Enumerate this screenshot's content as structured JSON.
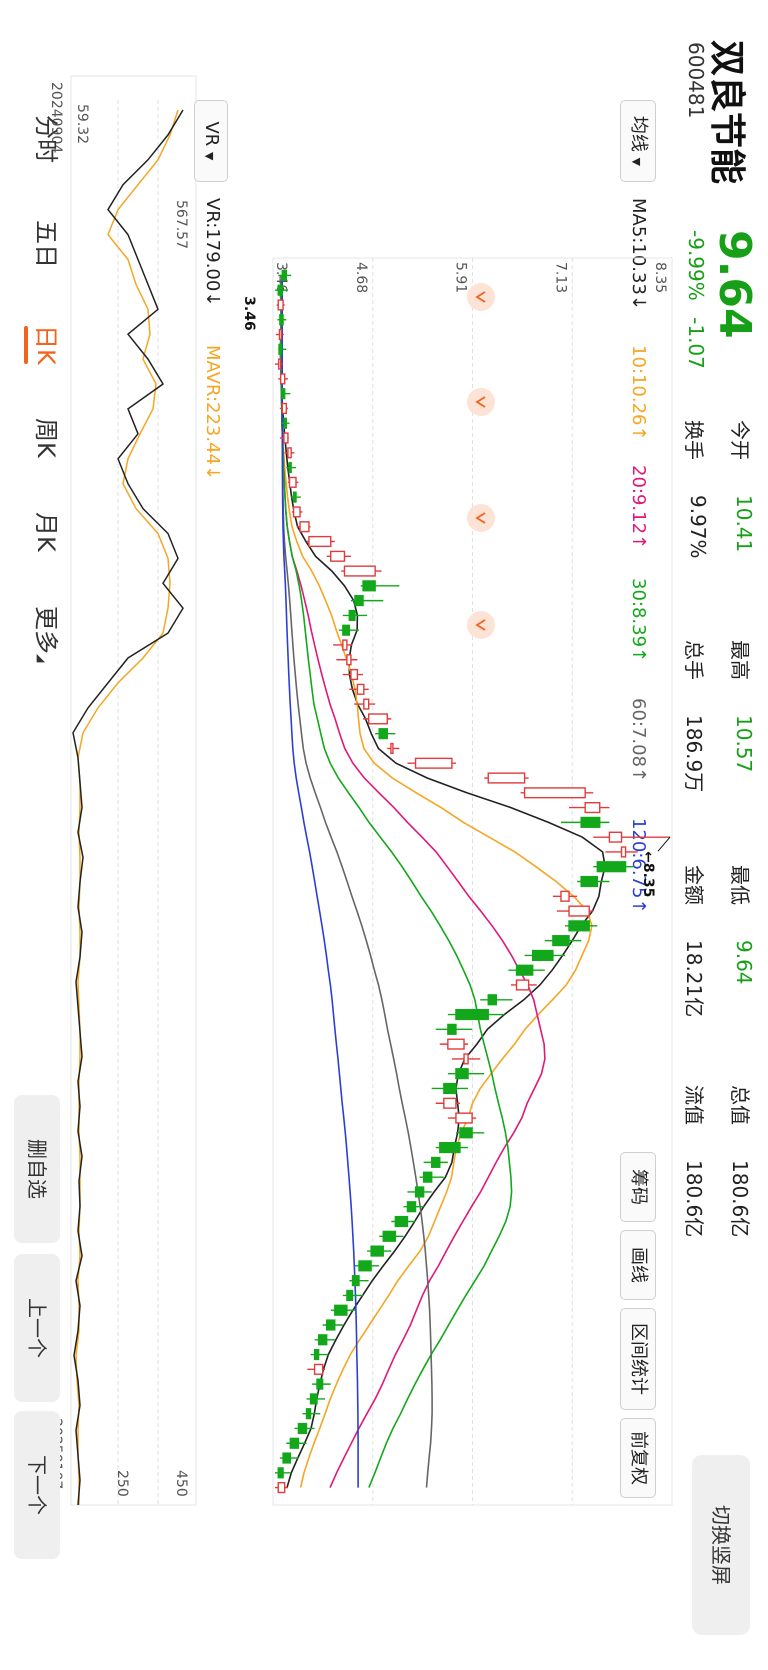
{
  "stock": {
    "name": "双良节能",
    "code": "600481",
    "price": "9.64",
    "change_pct": "-9.99%",
    "change": "-1.07"
  },
  "stats": [
    {
      "label": "今开",
      "value": "10.41",
      "color": "green"
    },
    {
      "label": "最高",
      "value": "10.57",
      "color": "green"
    },
    {
      "label": "最低",
      "value": "9.64",
      "color": "green"
    },
    {
      "label": "总值",
      "value": "180.6亿",
      "color": "dark"
    },
    {
      "label": "换手",
      "value": "9.97%",
      "color": "dark"
    },
    {
      "label": "总手",
      "value": "186.9万",
      "color": "dark"
    },
    {
      "label": "金额",
      "value": "18.21亿",
      "color": "dark"
    },
    {
      "label": "流值",
      "value": "180.6亿",
      "color": "dark"
    }
  ],
  "actions": {
    "switch_orientation": "切换竖屏",
    "chips": "筹码",
    "draw_line": "画线",
    "range_stats": "区间统计",
    "adjust": "前复权"
  },
  "ma_selector": "均线",
  "ma_legend": [
    {
      "text": "MA5:10.33↓",
      "color": "#222222"
    },
    {
      "text": "10:10.26↑",
      "color": "#f5a623"
    },
    {
      "text": "20:9.12↑",
      "color": "#e0187a"
    },
    {
      "text": "30:8.39↑",
      "color": "#13a81b"
    },
    {
      "text": "60:7.08↑",
      "color": "#666666"
    },
    {
      "text": "120:6.75↑",
      "color": "#2b3fd6"
    }
  ],
  "price_axis": [
    "8.35",
    "7.13",
    "5.91",
    "4.68",
    "3.46"
  ],
  "annotations": {
    "high_label": "8.35",
    "low_label": "3.46"
  },
  "indicator": {
    "selector": "VR",
    "legend": [
      {
        "text": "VR:179.00↓",
        "color": "#222222"
      },
      {
        "text": "MAVR:223.44↓",
        "color": "#f5a623"
      }
    ],
    "axis_left_top": "567.57",
    "axis_left_bottom": "59.32",
    "axis_right_top": "450",
    "axis_right_bottom": "250"
  },
  "dates": {
    "start": "20240904",
    "end": "20250107"
  },
  "tabs": [
    {
      "label": "分时",
      "active": false
    },
    {
      "label": "五日",
      "active": false
    },
    {
      "label": "日K",
      "active": true
    },
    {
      "label": "周K",
      "active": false
    },
    {
      "label": "月K",
      "active": false
    },
    {
      "label": "更多",
      "active": false
    }
  ],
  "side_buttons": [
    "删自选",
    "上一个",
    "下一个"
  ],
  "chart_data": {
    "type": "candlestick",
    "ohlc": [
      [
        3.6,
        3.66,
        3.5,
        3.55
      ],
      [
        3.55,
        3.62,
        3.46,
        3.5
      ],
      [
        3.5,
        3.58,
        3.48,
        3.56
      ],
      [
        3.56,
        3.6,
        3.49,
        3.52
      ],
      [
        3.52,
        3.57,
        3.47,
        3.54
      ],
      [
        3.54,
        3.6,
        3.5,
        3.51
      ],
      [
        3.51,
        3.56,
        3.46,
        3.53
      ],
      [
        3.53,
        3.62,
        3.5,
        3.58
      ],
      [
        3.58,
        3.65,
        3.53,
        3.55
      ],
      [
        3.55,
        3.62,
        3.52,
        3.6
      ],
      [
        3.6,
        3.64,
        3.54,
        3.57
      ],
      [
        3.57,
        3.63,
        3.52,
        3.62
      ],
      [
        3.62,
        3.7,
        3.58,
        3.66
      ],
      [
        3.66,
        3.72,
        3.6,
        3.64
      ],
      [
        3.64,
        3.75,
        3.62,
        3.72
      ],
      [
        3.72,
        3.78,
        3.66,
        3.69
      ],
      [
        3.69,
        3.8,
        3.67,
        3.77
      ],
      [
        3.77,
        3.9,
        3.73,
        3.88
      ],
      [
        3.88,
        4.2,
        3.85,
        4.15
      ],
      [
        4.15,
        4.4,
        4.1,
        4.32
      ],
      [
        4.32,
        4.78,
        4.28,
        4.7
      ],
      [
        4.7,
        5.0,
        4.52,
        4.55
      ],
      [
        4.55,
        4.8,
        4.4,
        4.45
      ],
      [
        4.45,
        4.6,
        4.3,
        4.38
      ],
      [
        4.38,
        4.5,
        4.25,
        4.3
      ],
      [
        4.3,
        4.42,
        4.18,
        4.35
      ],
      [
        4.35,
        4.48,
        4.22,
        4.4
      ],
      [
        4.4,
        4.55,
        4.3,
        4.48
      ],
      [
        4.48,
        4.62,
        4.38,
        4.56
      ],
      [
        4.56,
        4.7,
        4.44,
        4.62
      ],
      [
        4.62,
        4.9,
        4.55,
        4.85
      ],
      [
        4.85,
        4.95,
        4.7,
        4.75
      ],
      [
        4.9,
        5.0,
        4.85,
        4.92
      ],
      [
        5.2,
        5.7,
        5.1,
        5.65
      ],
      [
        6.1,
        6.6,
        6.05,
        6.55
      ],
      [
        6.55,
        7.4,
        6.5,
        7.3
      ],
      [
        7.3,
        7.6,
        7.1,
        7.48
      ],
      [
        7.48,
        7.6,
        7.0,
        7.25
      ],
      [
        7.6,
        8.35,
        7.4,
        7.75
      ],
      [
        7.75,
        7.95,
        7.55,
        7.8
      ],
      [
        7.8,
        7.9,
        7.4,
        7.45
      ],
      [
        7.45,
        7.6,
        7.2,
        7.25
      ],
      [
        7.0,
        7.2,
        6.9,
        7.1
      ],
      [
        7.1,
        7.4,
        6.95,
        7.35
      ],
      [
        7.35,
        7.45,
        7.05,
        7.1
      ],
      [
        7.1,
        7.25,
        6.8,
        6.9
      ],
      [
        6.9,
        7.05,
        6.55,
        6.65
      ],
      [
        6.65,
        6.8,
        6.35,
        6.45
      ],
      [
        6.45,
        6.7,
        6.38,
        6.6
      ],
      [
        6.2,
        6.4,
        6.0,
        6.1
      ],
      [
        6.1,
        6.3,
        5.6,
        5.7
      ],
      [
        5.7,
        5.9,
        5.45,
        5.6
      ],
      [
        5.6,
        5.85,
        5.5,
        5.8
      ],
      [
        5.8,
        6.0,
        5.65,
        5.85
      ],
      [
        5.85,
        6.05,
        5.6,
        5.7
      ],
      [
        5.7,
        5.85,
        5.4,
        5.55
      ],
      [
        5.55,
        5.75,
        5.45,
        5.7
      ],
      [
        5.7,
        5.95,
        5.6,
        5.9
      ],
      [
        5.9,
        6.05,
        5.7,
        5.75
      ],
      [
        5.75,
        5.85,
        5.45,
        5.5
      ],
      [
        5.5,
        5.6,
        5.3,
        5.4
      ],
      [
        5.4,
        5.55,
        5.25,
        5.3
      ],
      [
        5.3,
        5.4,
        5.1,
        5.2
      ],
      [
        5.2,
        5.3,
        5.05,
        5.1
      ],
      [
        5.1,
        5.2,
        4.9,
        4.95
      ],
      [
        4.95,
        5.05,
        4.75,
        4.8
      ],
      [
        4.8,
        4.9,
        4.6,
        4.65
      ],
      [
        4.65,
        4.75,
        4.45,
        4.5
      ],
      [
        4.5,
        4.62,
        4.38,
        4.42
      ],
      [
        4.42,
        4.55,
        4.3,
        4.35
      ],
      [
        4.35,
        4.45,
        4.15,
        4.2
      ],
      [
        4.2,
        4.3,
        4.05,
        4.1
      ],
      [
        4.1,
        4.2,
        3.95,
        4.0
      ],
      [
        4.0,
        4.12,
        3.9,
        3.95
      ],
      [
        3.95,
        4.08,
        3.86,
        4.05
      ],
      [
        4.05,
        4.15,
        3.92,
        3.98
      ],
      [
        3.98,
        4.08,
        3.85,
        3.9
      ],
      [
        3.9,
        4.02,
        3.8,
        3.85
      ],
      [
        3.85,
        3.95,
        3.7,
        3.75
      ],
      [
        3.75,
        3.85,
        3.6,
        3.65
      ],
      [
        3.65,
        3.75,
        3.52,
        3.56
      ],
      [
        3.56,
        3.66,
        3.46,
        3.5
      ],
      [
        3.5,
        3.62,
        3.46,
        3.58
      ]
    ]
  }
}
